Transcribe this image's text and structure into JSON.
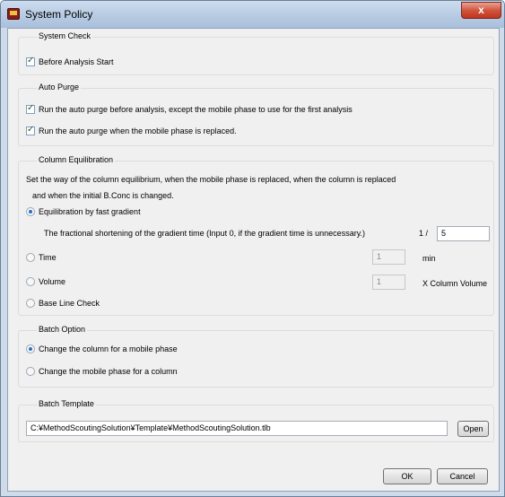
{
  "window": {
    "title": "System Policy",
    "close_glyph": "x",
    "icon": "app-icon"
  },
  "system_check": {
    "legend": "System Check",
    "before_analysis_start": {
      "label": "Before Analysis Start",
      "checked": true
    }
  },
  "auto_purge": {
    "legend": "Auto Purge",
    "before_analysis": {
      "label": "Run the auto purge before analysis, except the mobile phase to use for the first analysis",
      "checked": true
    },
    "mobile_phase_replaced": {
      "label": "Run the auto purge when the mobile phase is replaced.",
      "checked": true
    }
  },
  "column_equilibration": {
    "legend": "Column Equilibration",
    "description_line1": "Set the way of the column equilibrium, when the mobile phase is replaced, when the column is replaced",
    "description_line2": "and when the initial B.Conc is changed.",
    "fast_gradient": {
      "label": "Equilibration by fast gradient",
      "selected": true
    },
    "fractional_label": "The fractional shortening of the gradient time (Input 0, if the gradient time is unnecessary.)",
    "fraction_prefix": "1 /",
    "fraction_value": "5",
    "time": {
      "label": "Time",
      "value": "1",
      "unit": "min",
      "selected": false
    },
    "volume": {
      "label": "Volume",
      "value": "1",
      "unit": "X Column Volume",
      "selected": false
    },
    "base_line_check": {
      "label": "Base Line Check",
      "selected": false
    }
  },
  "batch_option": {
    "legend": "Batch Option",
    "change_column": {
      "label": "Change the column for a mobile phase",
      "selected": true
    },
    "change_mobile_phase": {
      "label": "Change the mobile phase for a column",
      "selected": false
    }
  },
  "batch_template": {
    "legend": "Batch Template",
    "path": "C:¥MethodScoutingSolution¥Template¥MethodScoutingSolution.tlb",
    "open_label": "Open"
  },
  "footer": {
    "ok_label": "OK",
    "cancel_label": "Cancel"
  },
  "colors": {
    "title_bar": "#b7cbe3",
    "close_button": "#c0351d",
    "radio_dot": "#2a6fc9",
    "check_mark": "#2c5d3a"
  }
}
